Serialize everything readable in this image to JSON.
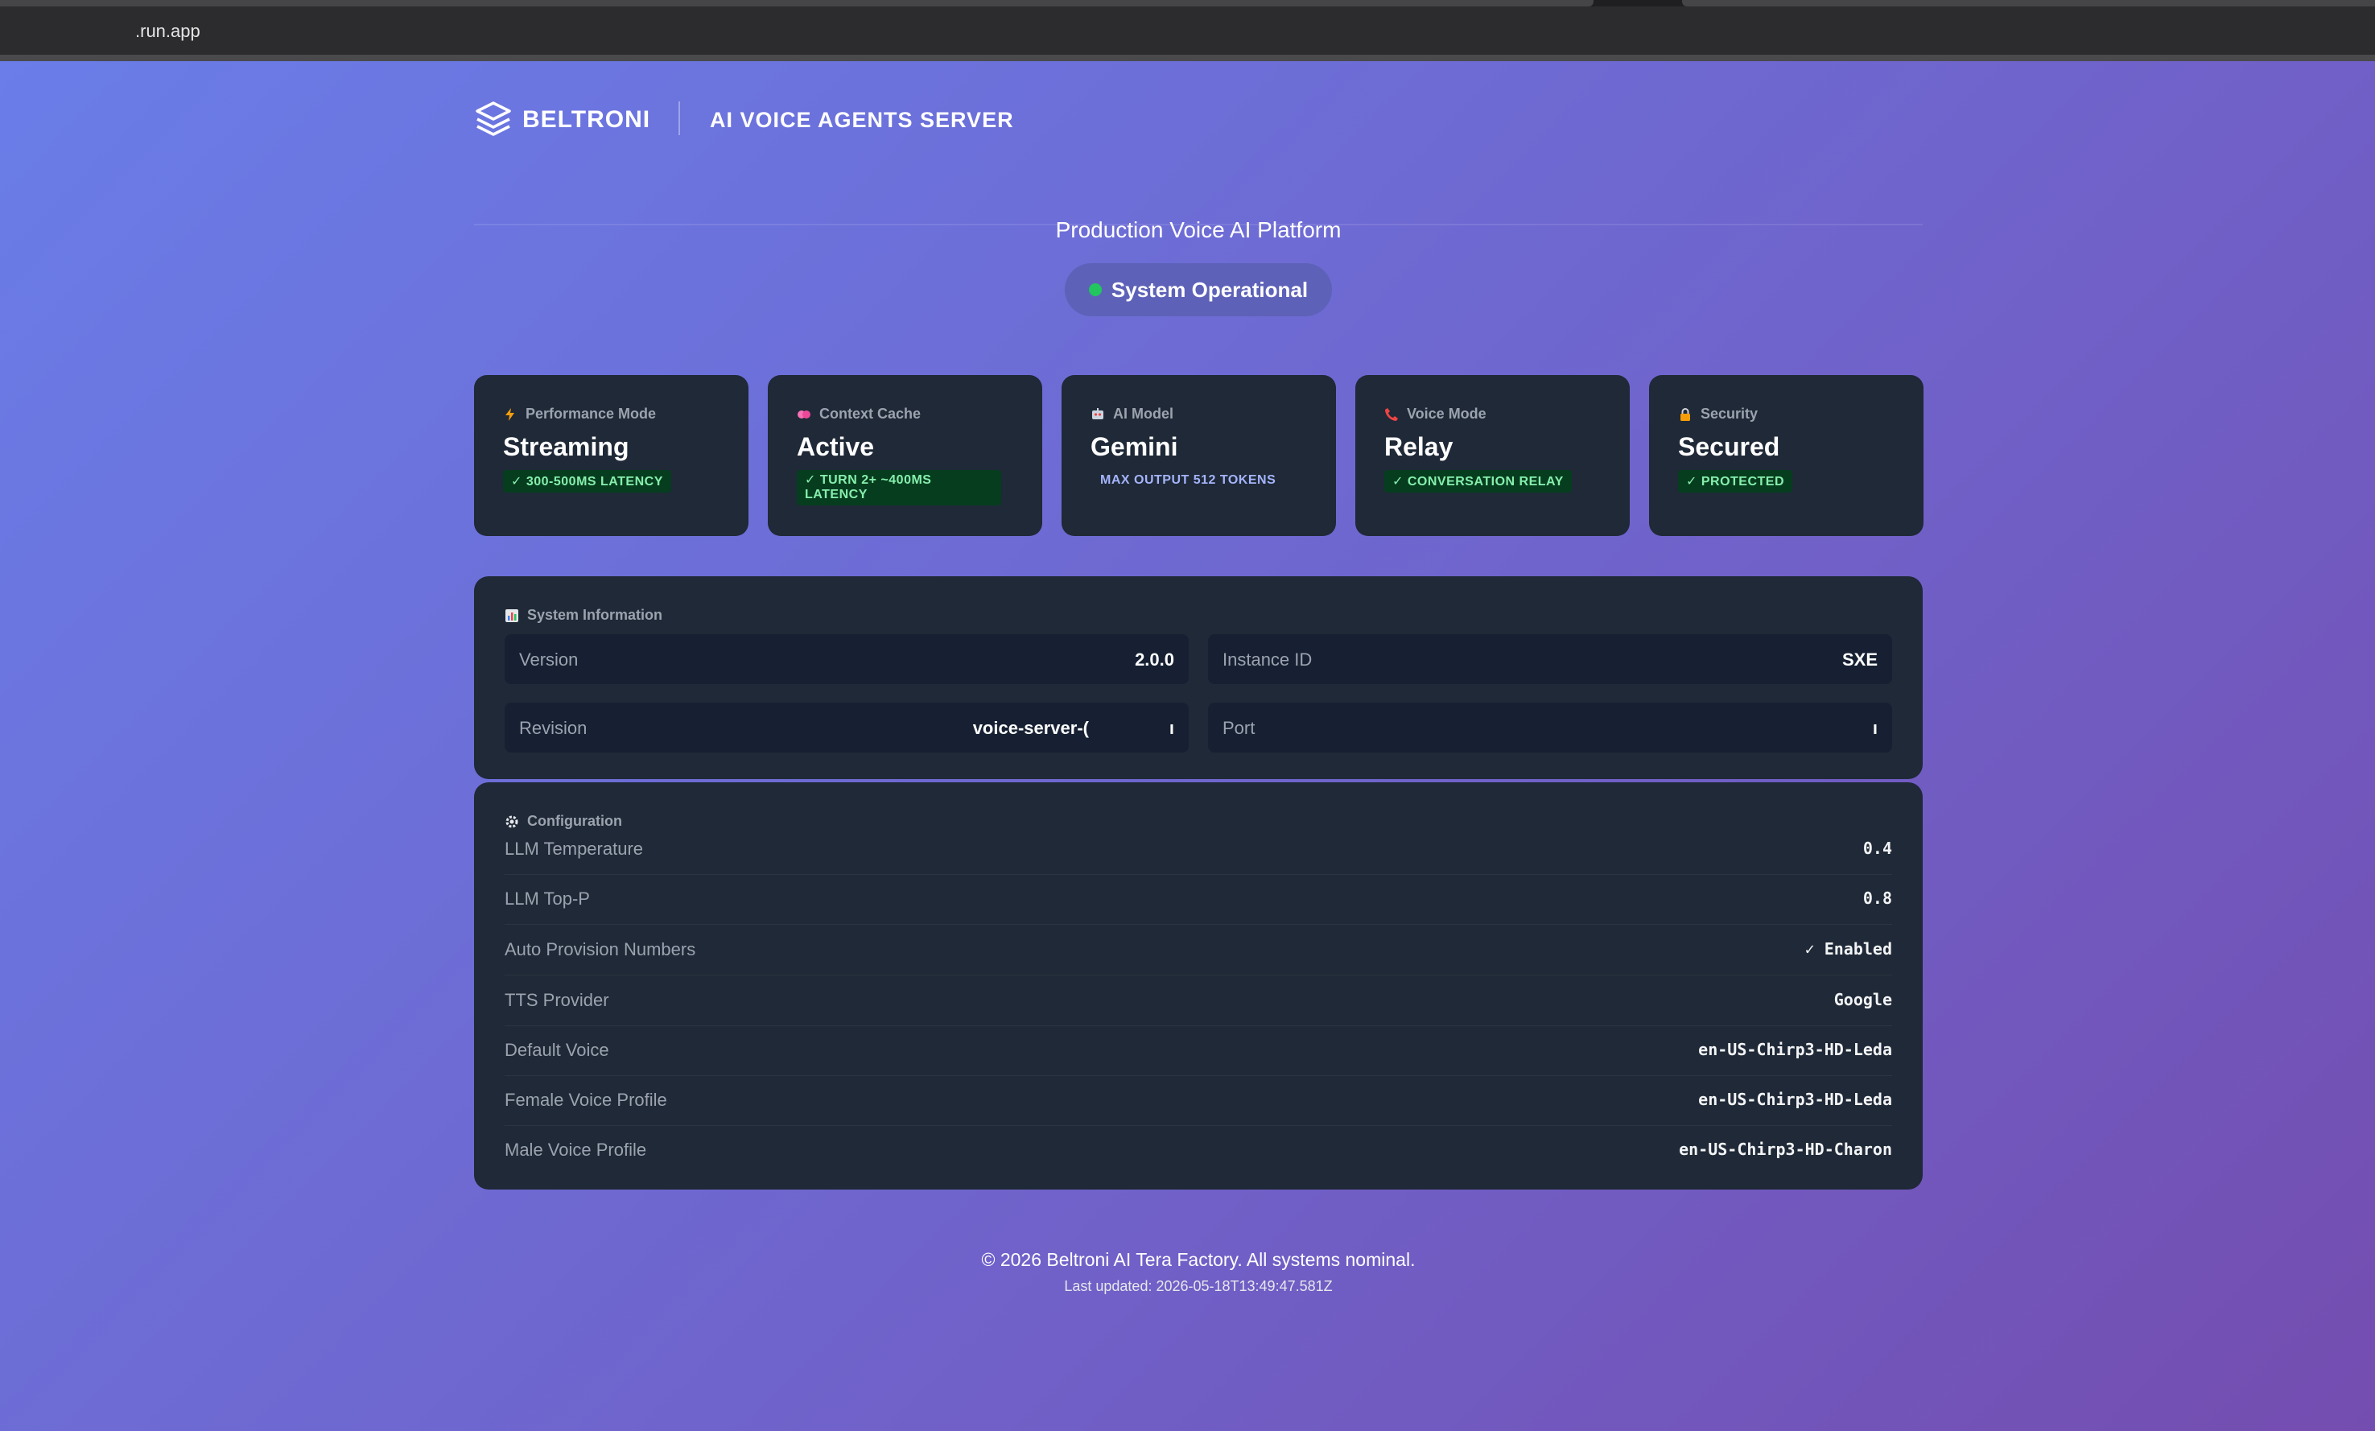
{
  "browser": {
    "url": ".run.app"
  },
  "header": {
    "brand": "BELTRONI",
    "subtitle": "AI VOICE AGENTS SERVER"
  },
  "hero": {
    "tagline": "Production Voice AI Platform",
    "status": "System Operational"
  },
  "cards": [
    {
      "label": "Performance Mode",
      "icon": "lightning-icon",
      "value": "Streaming",
      "badge": "✓ 300-500MS LATENCY"
    },
    {
      "label": "Context Cache",
      "icon": "brain-icon",
      "value": "Active",
      "badge": "✓ TURN 2+ ~400MS LATENCY"
    },
    {
      "label": "AI Model",
      "icon": "robot-icon",
      "value": "Gemini",
      "note": "MAX OUTPUT 512 TOKENS"
    },
    {
      "label": "Voice Mode",
      "icon": "phone-icon",
      "value": "Relay",
      "badge": "✓ CONVERSATION RELAY"
    },
    {
      "label": "Security",
      "icon": "lock-icon",
      "value": "Secured",
      "badge": "✓ PROTECTED"
    }
  ],
  "system_info": {
    "title": "System Information",
    "version_label": "Version",
    "version": "2.0.0",
    "instance_label": "Instance ID",
    "instance": "SXE",
    "revision_label": "Revision",
    "revision": "voice-server-(",
    "port_label": "Port",
    "port": "ı"
  },
  "config": {
    "title": "Configuration",
    "rows": [
      {
        "label": "LLM Temperature",
        "value": "0.4"
      },
      {
        "label": "LLM Top-P",
        "value": "0.8"
      },
      {
        "label": "Auto Provision Numbers",
        "value": "✓ Enabled"
      },
      {
        "label": "TTS Provider",
        "value": "Google"
      },
      {
        "label": "Default Voice",
        "value": "en-US-Chirp3-HD-Leda"
      },
      {
        "label": "Female Voice Profile",
        "value": "en-US-Chirp3-HD-Leda"
      },
      {
        "label": "Male Voice Profile",
        "value": "en-US-Chirp3-HD-Charon"
      }
    ]
  },
  "footer": {
    "copyright": "© 2026 Beltroni AI Tera Factory. All systems nominal.",
    "updated": "Last updated: 2026-05-18T13:49:47.581Z"
  },
  "colors": {
    "accent_green": "#22c55e",
    "card_bg": "#1f2937",
    "badge_bg": "#063d1f"
  }
}
